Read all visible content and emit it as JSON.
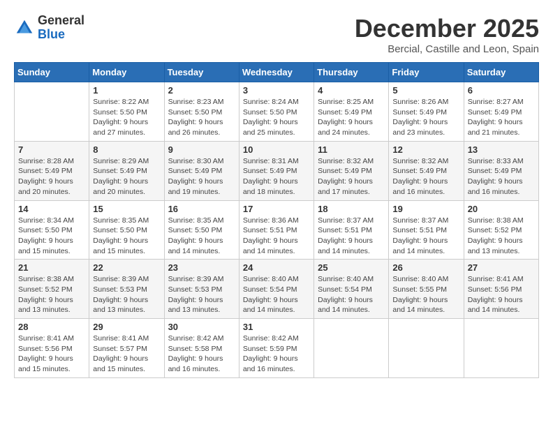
{
  "header": {
    "logo_general": "General",
    "logo_blue": "Blue",
    "month_title": "December 2025",
    "location": "Bercial, Castille and Leon, Spain"
  },
  "calendar": {
    "days_of_week": [
      "Sunday",
      "Monday",
      "Tuesday",
      "Wednesday",
      "Thursday",
      "Friday",
      "Saturday"
    ],
    "weeks": [
      [
        {
          "day": "",
          "info": ""
        },
        {
          "day": "1",
          "info": "Sunrise: 8:22 AM\nSunset: 5:50 PM\nDaylight: 9 hours\nand 27 minutes."
        },
        {
          "day": "2",
          "info": "Sunrise: 8:23 AM\nSunset: 5:50 PM\nDaylight: 9 hours\nand 26 minutes."
        },
        {
          "day": "3",
          "info": "Sunrise: 8:24 AM\nSunset: 5:50 PM\nDaylight: 9 hours\nand 25 minutes."
        },
        {
          "day": "4",
          "info": "Sunrise: 8:25 AM\nSunset: 5:49 PM\nDaylight: 9 hours\nand 24 minutes."
        },
        {
          "day": "5",
          "info": "Sunrise: 8:26 AM\nSunset: 5:49 PM\nDaylight: 9 hours\nand 23 minutes."
        },
        {
          "day": "6",
          "info": "Sunrise: 8:27 AM\nSunset: 5:49 PM\nDaylight: 9 hours\nand 21 minutes."
        }
      ],
      [
        {
          "day": "7",
          "info": "Sunrise: 8:28 AM\nSunset: 5:49 PM\nDaylight: 9 hours\nand 20 minutes."
        },
        {
          "day": "8",
          "info": "Sunrise: 8:29 AM\nSunset: 5:49 PM\nDaylight: 9 hours\nand 20 minutes."
        },
        {
          "day": "9",
          "info": "Sunrise: 8:30 AM\nSunset: 5:49 PM\nDaylight: 9 hours\nand 19 minutes."
        },
        {
          "day": "10",
          "info": "Sunrise: 8:31 AM\nSunset: 5:49 PM\nDaylight: 9 hours\nand 18 minutes."
        },
        {
          "day": "11",
          "info": "Sunrise: 8:32 AM\nSunset: 5:49 PM\nDaylight: 9 hours\nand 17 minutes."
        },
        {
          "day": "12",
          "info": "Sunrise: 8:32 AM\nSunset: 5:49 PM\nDaylight: 9 hours\nand 16 minutes."
        },
        {
          "day": "13",
          "info": "Sunrise: 8:33 AM\nSunset: 5:49 PM\nDaylight: 9 hours\nand 16 minutes."
        }
      ],
      [
        {
          "day": "14",
          "info": "Sunrise: 8:34 AM\nSunset: 5:50 PM\nDaylight: 9 hours\nand 15 minutes."
        },
        {
          "day": "15",
          "info": "Sunrise: 8:35 AM\nSunset: 5:50 PM\nDaylight: 9 hours\nand 15 minutes."
        },
        {
          "day": "16",
          "info": "Sunrise: 8:35 AM\nSunset: 5:50 PM\nDaylight: 9 hours\nand 14 minutes."
        },
        {
          "day": "17",
          "info": "Sunrise: 8:36 AM\nSunset: 5:51 PM\nDaylight: 9 hours\nand 14 minutes."
        },
        {
          "day": "18",
          "info": "Sunrise: 8:37 AM\nSunset: 5:51 PM\nDaylight: 9 hours\nand 14 minutes."
        },
        {
          "day": "19",
          "info": "Sunrise: 8:37 AM\nSunset: 5:51 PM\nDaylight: 9 hours\nand 14 minutes."
        },
        {
          "day": "20",
          "info": "Sunrise: 8:38 AM\nSunset: 5:52 PM\nDaylight: 9 hours\nand 13 minutes."
        }
      ],
      [
        {
          "day": "21",
          "info": "Sunrise: 8:38 AM\nSunset: 5:52 PM\nDaylight: 9 hours\nand 13 minutes."
        },
        {
          "day": "22",
          "info": "Sunrise: 8:39 AM\nSunset: 5:53 PM\nDaylight: 9 hours\nand 13 minutes."
        },
        {
          "day": "23",
          "info": "Sunrise: 8:39 AM\nSunset: 5:53 PM\nDaylight: 9 hours\nand 13 minutes."
        },
        {
          "day": "24",
          "info": "Sunrise: 8:40 AM\nSunset: 5:54 PM\nDaylight: 9 hours\nand 14 minutes."
        },
        {
          "day": "25",
          "info": "Sunrise: 8:40 AM\nSunset: 5:54 PM\nDaylight: 9 hours\nand 14 minutes."
        },
        {
          "day": "26",
          "info": "Sunrise: 8:40 AM\nSunset: 5:55 PM\nDaylight: 9 hours\nand 14 minutes."
        },
        {
          "day": "27",
          "info": "Sunrise: 8:41 AM\nSunset: 5:56 PM\nDaylight: 9 hours\nand 14 minutes."
        }
      ],
      [
        {
          "day": "28",
          "info": "Sunrise: 8:41 AM\nSunset: 5:56 PM\nDaylight: 9 hours\nand 15 minutes."
        },
        {
          "day": "29",
          "info": "Sunrise: 8:41 AM\nSunset: 5:57 PM\nDaylight: 9 hours\nand 15 minutes."
        },
        {
          "day": "30",
          "info": "Sunrise: 8:42 AM\nSunset: 5:58 PM\nDaylight: 9 hours\nand 16 minutes."
        },
        {
          "day": "31",
          "info": "Sunrise: 8:42 AM\nSunset: 5:59 PM\nDaylight: 9 hours\nand 16 minutes."
        },
        {
          "day": "",
          "info": ""
        },
        {
          "day": "",
          "info": ""
        },
        {
          "day": "",
          "info": ""
        }
      ]
    ]
  }
}
